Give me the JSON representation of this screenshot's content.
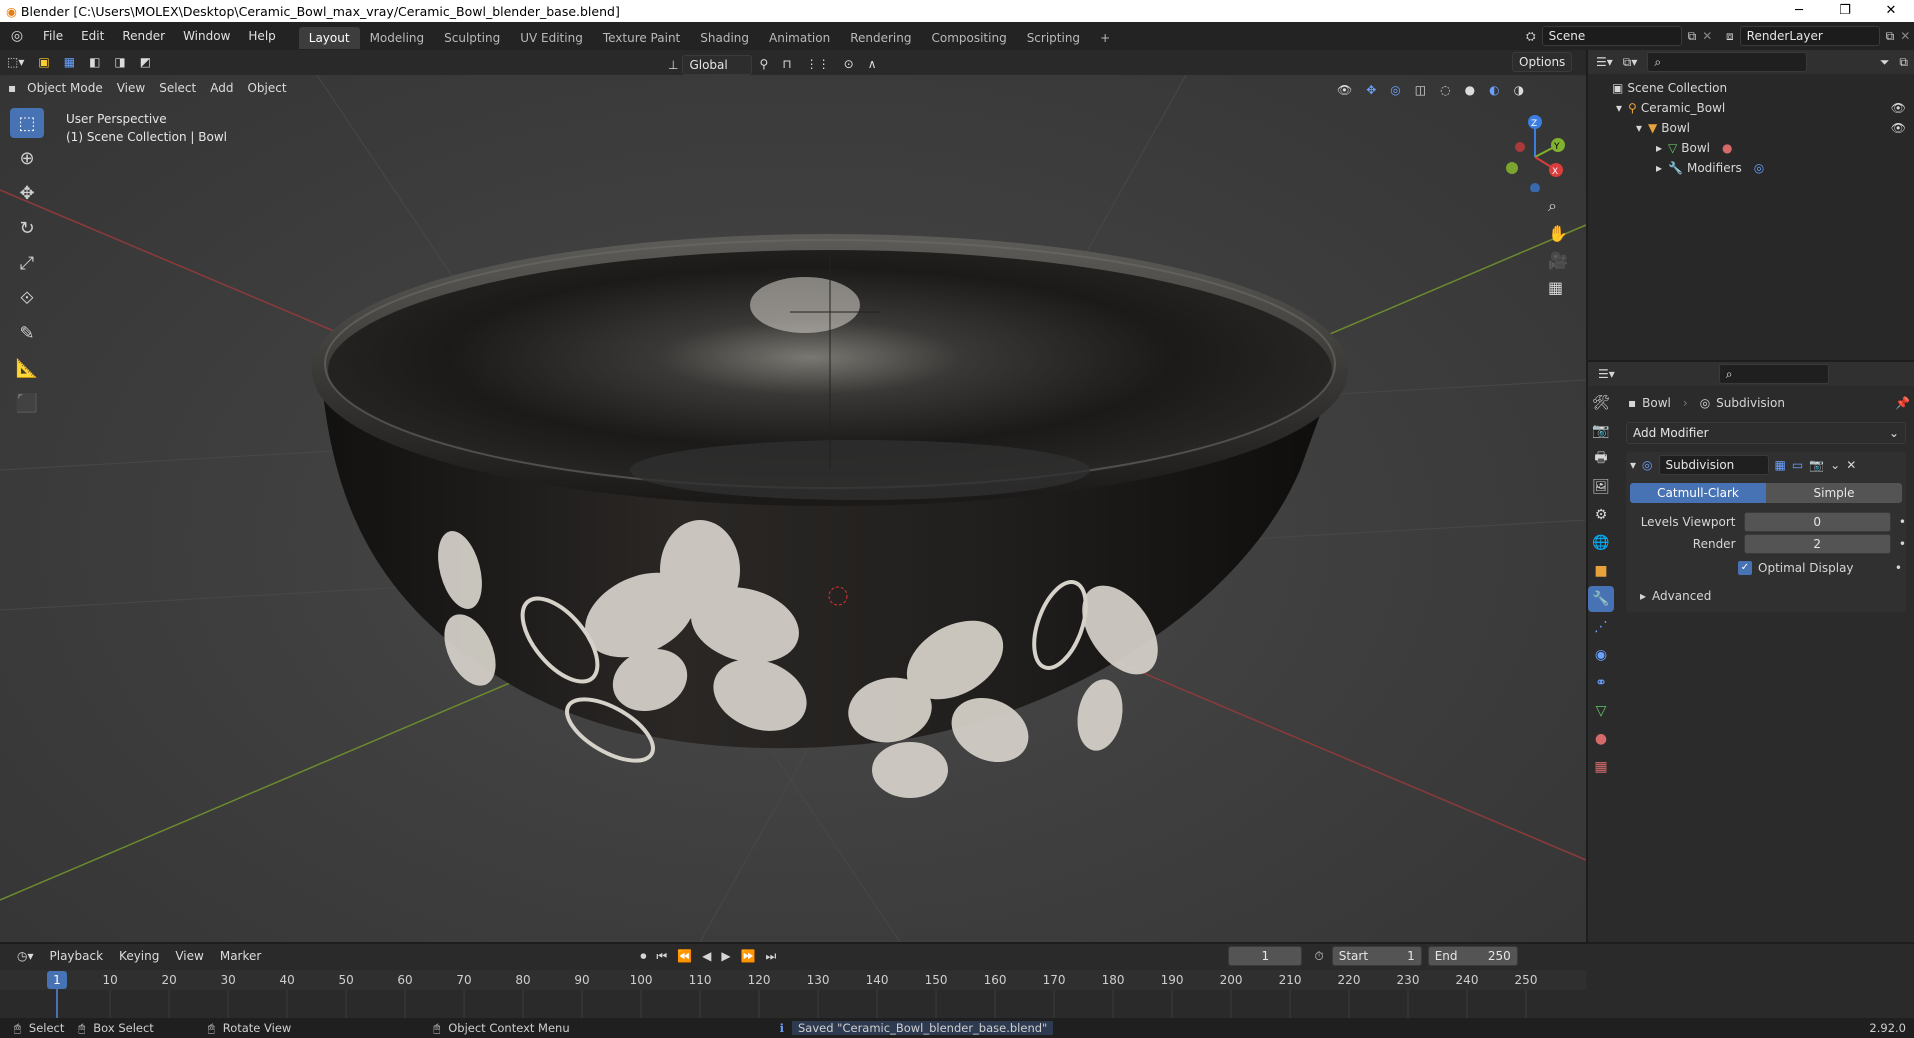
{
  "window": {
    "title": "Blender [C:\\Users\\MOLEX\\Desktop\\Ceramic_Bowl_max_vray/Ceramic_Bowl_blender_base.blend]",
    "minimize": "─",
    "maximize": "❐",
    "close": "✕"
  },
  "menubar": {
    "menus": [
      "File",
      "Edit",
      "Render",
      "Window",
      "Help"
    ],
    "workspaces": [
      "Layout",
      "Modeling",
      "Sculpting",
      "UV Editing",
      "Texture Paint",
      "Shading",
      "Animation",
      "Rendering",
      "Compositing",
      "Scripting"
    ],
    "active_workspace": "Layout",
    "add_workspace": "+",
    "scene_value": "Scene",
    "view_layer_value": "RenderLayer"
  },
  "viewport": {
    "transform_orientation": "Global",
    "options_label": "Options",
    "mode": "Object Mode",
    "menus": [
      "View",
      "Select",
      "Add",
      "Object"
    ],
    "overlay_line1": "User Perspective",
    "overlay_line2": "(1) Scene Collection | Bowl",
    "gizmo": {
      "z": "Z",
      "y": "Y",
      "x": "X"
    }
  },
  "outliner": {
    "search_placeholder": "",
    "items": [
      {
        "label": "Scene Collection",
        "indent": 0
      },
      {
        "label": "Ceramic_Bowl",
        "indent": 1
      },
      {
        "label": "Bowl",
        "indent": 2
      },
      {
        "label": "Bowl",
        "indent": 3
      },
      {
        "label": "Modifiers",
        "indent": 3
      }
    ]
  },
  "properties": {
    "object_name": "Bowl",
    "modifier_breadcrumb": "Subdivision",
    "add_modifier": "Add Modifier",
    "modifier": {
      "name": "Subdivision",
      "algo_options": [
        "Catmull-Clark",
        "Simple"
      ],
      "active_algo": "Catmull-Clark",
      "levels_viewport_label": "Levels Viewport",
      "levels_viewport_value": "0",
      "render_label": "Render",
      "render_value": "2",
      "optimal_display_label": "Optimal Display",
      "optimal_display_checked": true,
      "advanced_label": "Advanced"
    }
  },
  "timeline": {
    "menus": [
      "Playback",
      "Keying",
      "View",
      "Marker"
    ],
    "current_frame": "1",
    "start_label": "Start",
    "start_value": "1",
    "end_label": "End",
    "end_value": "250",
    "ticks": [
      "1",
      "10",
      "20",
      "30",
      "40",
      "50",
      "60",
      "70",
      "80",
      "90",
      "100",
      "110",
      "120",
      "130",
      "140",
      "150",
      "160",
      "170",
      "180",
      "190",
      "200",
      "210",
      "220",
      "230",
      "240",
      "250"
    ]
  },
  "statusbar": {
    "select": "Select",
    "box_select": "Box Select",
    "rotate_view": "Rotate View",
    "context_menu": "Object Context Menu",
    "message": "Saved \"Ceramic_Bowl_blender_base.blend\"",
    "version": "2.92.0"
  },
  "colors": {
    "accent": "#4772b3",
    "active_tab": "#3d3d3d",
    "bg": "#1d1d1d"
  }
}
